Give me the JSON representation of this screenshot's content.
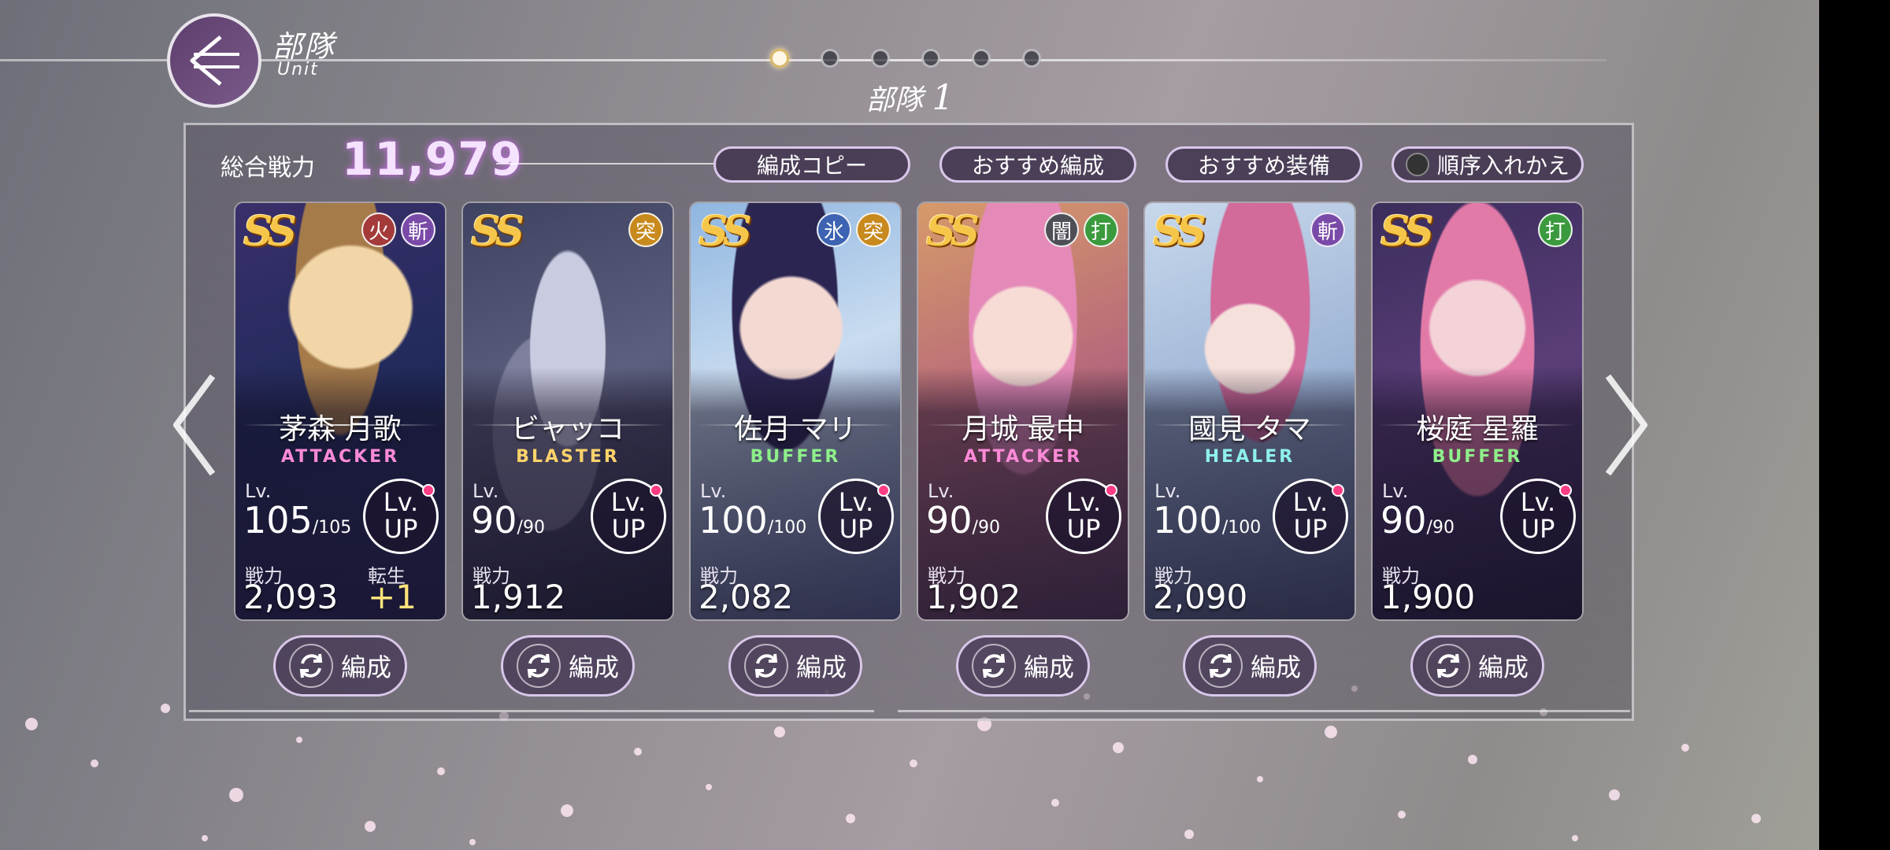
{
  "header": {
    "title": "部隊",
    "subtitle": "Unit",
    "unit_prefix": "部隊",
    "unit_number": "1",
    "page_count": 6,
    "active_page": 1
  },
  "summary": {
    "power_label": "総合戦力",
    "power_value": "11,979"
  },
  "toolbar": {
    "copy_label": "編成コピー",
    "recommend_formation_label": "おすすめ編成",
    "recommend_equip_label": "おすすめ装備",
    "reorder_label": "順序入れかえ",
    "reorder_on": false
  },
  "common": {
    "lv_label": "Lv.",
    "lvup_line1": "Lv.",
    "lvup_line2": "UP",
    "power_label": "戦力",
    "rebirth_label": "転生",
    "edit_label": "編成",
    "rarity": "SS"
  },
  "cards": [
    {
      "name": "茅森 月歌",
      "role": "ATTACKER",
      "level": "105",
      "max_level": "/105",
      "power": "2,093",
      "attributes": [
        "火",
        "斬"
      ],
      "rebirth": "+1"
    },
    {
      "name": "ビャッコ",
      "role": "BLASTER",
      "level": "90",
      "max_level": "/90",
      "power": "1,912",
      "attributes": [
        "突"
      ],
      "rebirth": ""
    },
    {
      "name": "佐月 マリ",
      "role": "BUFFER",
      "level": "100",
      "max_level": "/100",
      "power": "2,082",
      "attributes": [
        "氷",
        "突"
      ],
      "rebirth": ""
    },
    {
      "name": "月城 最中",
      "role": "ATTACKER",
      "level": "90",
      "max_level": "/90",
      "power": "1,902",
      "attributes": [
        "闇",
        "打"
      ],
      "rebirth": ""
    },
    {
      "name": "國見 タマ",
      "role": "HEALER",
      "level": "100",
      "max_level": "/100",
      "power": "2,090",
      "attributes": [
        "斬"
      ],
      "rebirth": ""
    },
    {
      "name": "桜庭 星羅",
      "role": "BUFFER",
      "level": "90",
      "max_level": "/90",
      "power": "1,900",
      "attributes": [
        "打"
      ],
      "rebirth": ""
    }
  ],
  "colors": {
    "attacker": "#ff8ad8",
    "blaster": "#ffd36a",
    "buffer": "#8ef08a",
    "healer": "#8ef2ea",
    "lvup_dot": "#ff3d84"
  }
}
